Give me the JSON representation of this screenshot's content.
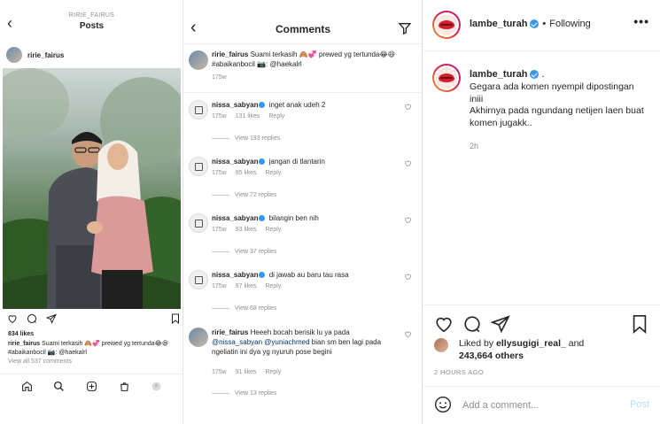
{
  "mobile_post": {
    "header_username": "RIRIE_FAIRUS",
    "header_title": "Posts",
    "author": "ririe_fairus",
    "likes": "834 likes",
    "caption_user": "ririe_fairus",
    "caption_text": "Suami terkasih 🙈💞 prewed yg tertunda😂😆#abaikanbocil 📷: @haekalrl",
    "view_all": "View all 537 comments"
  },
  "comments_panel": {
    "title": "Comments",
    "caption": {
      "user": "ririe_fairus",
      "text": "Suami terkasih 🙈💞 prewed yg tertunda😂😆#abaikanbocil 📷: @haekalrl",
      "time": "175w"
    },
    "comments": [
      {
        "user": "nissa_sabyan",
        "text": "inget anak udeh 2",
        "time": "175w",
        "likes": "131 likes",
        "reply": "Reply",
        "view_replies": "View 193 replies"
      },
      {
        "user": "nissa_sabyan",
        "text": "jangan di tlantarin",
        "time": "175w",
        "likes": "95 likes",
        "reply": "Reply",
        "view_replies": "View 72 replies"
      },
      {
        "user": "nissa_sabyan",
        "text": "bilangin ben nih",
        "time": "175w",
        "likes": "93 likes",
        "reply": "Reply",
        "view_replies": "View 37 replies"
      },
      {
        "user": "nissa_sabyan",
        "text": "di jawab au baru tau rasa",
        "time": "175w",
        "likes": "97 likes",
        "reply": "Reply",
        "view_replies": "View 68 replies"
      },
      {
        "user": "ririe_fairus",
        "text_a": "Heeeh bocah berisik lu ya pada",
        "mention1": "@nissa_sabyan",
        "mention2": "@yuniachmed",
        "text_b": "bian sm ben lagi pada ngeliatin ini dya yg nyuruh pose begini",
        "time": "175w",
        "likes": "91 likes",
        "reply": "Reply",
        "view_replies": "View 13 replies"
      }
    ]
  },
  "desktop_post": {
    "username": "lambe_turah",
    "separator": "•",
    "following": "Following",
    "more": "•••",
    "post_user": "lambe_turah",
    "post_dot": ".",
    "post_text": "Gegara ada komen nyempil dipostingan iniii\nAkhirnya pada ngundang netijen laen buat komen jugakk..",
    "post_age": "2h",
    "liked_by_prefix": "Liked by",
    "liked_by_user": "ellysugigi_real_",
    "liked_by_and": "and",
    "liked_by_count": "243,664 others",
    "time_ago": "2 HOURS AGO",
    "comment_placeholder": "Add a comment...",
    "post_button": "Post"
  }
}
